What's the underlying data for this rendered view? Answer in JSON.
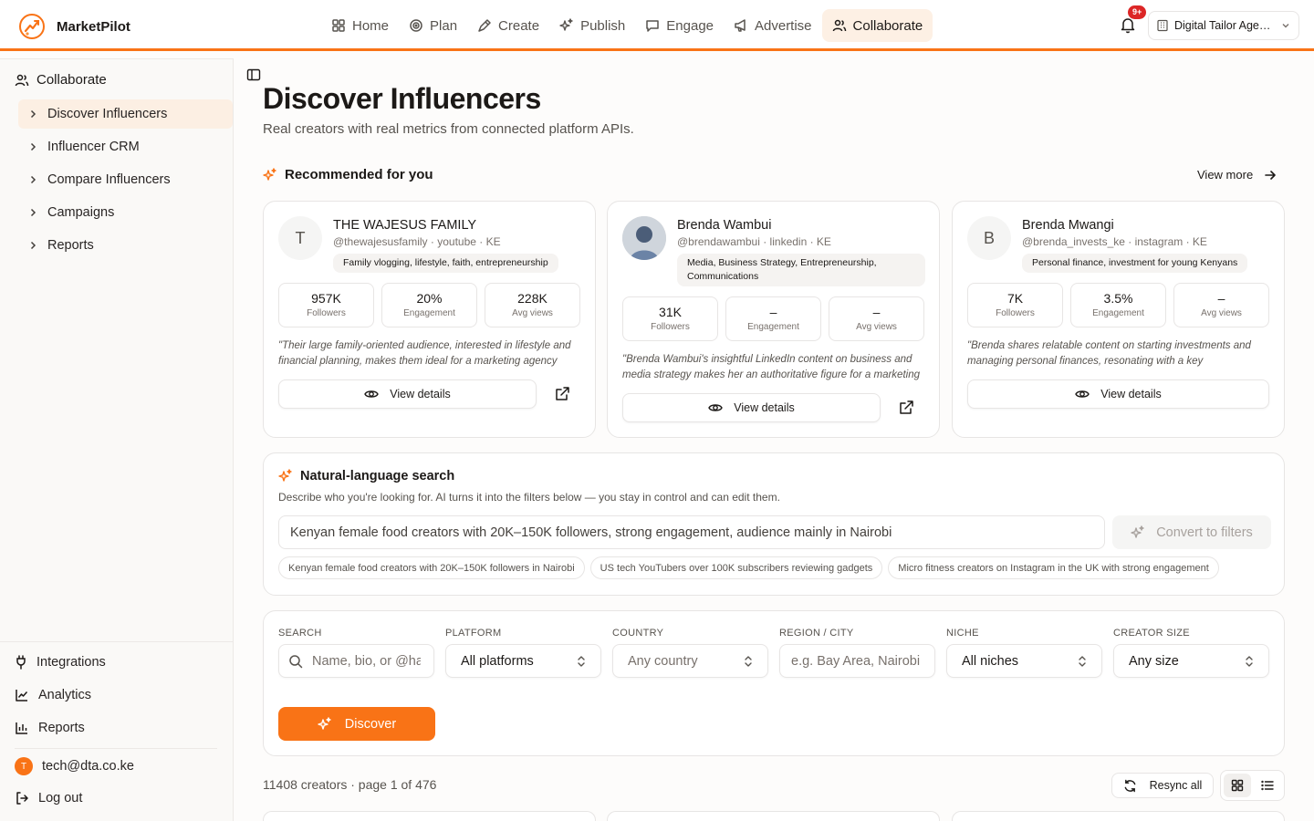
{
  "app": {
    "name": "MarketPilot"
  },
  "nav": {
    "items": [
      {
        "label": "Home",
        "icon": "grid-icon"
      },
      {
        "label": "Plan",
        "icon": "target-icon"
      },
      {
        "label": "Create",
        "icon": "pen-icon"
      },
      {
        "label": "Publish",
        "icon": "sparkles-icon"
      },
      {
        "label": "Engage",
        "icon": "message-icon"
      },
      {
        "label": "Advertise",
        "icon": "megaphone-icon"
      },
      {
        "label": "Collaborate",
        "icon": "users-icon",
        "active": true
      }
    ]
  },
  "notifications": {
    "badge": "9+"
  },
  "org": {
    "name": "Digital Tailor Agen..."
  },
  "sidebar": {
    "section": "Collaborate",
    "items": [
      {
        "label": "Discover Influencers",
        "active": true
      },
      {
        "label": "Influencer CRM"
      },
      {
        "label": "Compare Influencers"
      },
      {
        "label": "Campaigns"
      },
      {
        "label": "Reports"
      }
    ],
    "bottom": [
      {
        "label": "Integrations",
        "icon": "plug-icon"
      },
      {
        "label": "Analytics",
        "icon": "line-chart-icon"
      },
      {
        "label": "Reports",
        "icon": "bar-chart-icon"
      }
    ],
    "user": {
      "initial": "T",
      "email": "tech@dta.co.ke"
    },
    "logout": "Log out"
  },
  "page": {
    "title": "Discover Influencers",
    "subtitle": "Real creators with real metrics from connected platform APIs."
  },
  "recommended": {
    "title": "Recommended for you",
    "view_more": "View more",
    "cards": [
      {
        "initial": "T",
        "name": "THE WAJESUS FAMILY",
        "handle": "@thewajesusfamily · youtube · KE",
        "tag": "Family vlogging, lifestyle, faith, entrepreneurship",
        "stats": [
          {
            "value": "957K",
            "label": "Followers"
          },
          {
            "value": "20%",
            "label": "Engagement"
          },
          {
            "value": "228K",
            "label": "Avg views"
          }
        ],
        "quote": "\"Their large family-oriented audience, interested in lifestyle and financial planning, makes them ideal for a marketing agency targeting families.\"",
        "button": "View details"
      },
      {
        "initial": "",
        "name": "Brenda Wambui",
        "handle": "@brendawambui · linkedin · KE",
        "tag": "Media, Business Strategy, Entrepreneurship, Communications",
        "stats": [
          {
            "value": "31K",
            "label": "Followers"
          },
          {
            "value": "–",
            "label": "Engagement"
          },
          {
            "value": "–",
            "label": "Avg views"
          }
        ],
        "quote": "\"Brenda Wambui's insightful LinkedIn content on business and media strategy makes her an authoritative figure for a marketing agency.\"",
        "button": "View details"
      },
      {
        "initial": "B",
        "name": "Brenda Mwangi",
        "handle": "@brenda_invests_ke · instagram · KE",
        "tag": "Personal finance, investment for young Kenyans",
        "stats": [
          {
            "value": "7K",
            "label": "Followers"
          },
          {
            "value": "3.5%",
            "label": "Engagement"
          },
          {
            "value": "–",
            "label": "Avg views"
          }
        ],
        "quote": "\"Brenda shares relatable content on starting investments and managing personal finances, resonating with a key demographic.\"",
        "button": "View details"
      }
    ]
  },
  "nl_search": {
    "title": "Natural-language search",
    "description": "Describe who you're looking for. AI turns it into the filters below — you stay in control and can edit them.",
    "value": "Kenyan female food creators with 20K–150K followers, strong engagement, audience mainly in Nairobi",
    "convert_label": "Convert to filters",
    "examples": [
      "Kenyan female food creators with 20K–150K followers in Nairobi",
      "US tech YouTubers over 100K subscribers reviewing gadgets",
      "Micro fitness creators on Instagram in the UK with strong engagement"
    ]
  },
  "filters": {
    "search": {
      "label": "SEARCH",
      "placeholder": "Name, bio, or @handle"
    },
    "platform": {
      "label": "PLATFORM",
      "value": "All platforms"
    },
    "country": {
      "label": "COUNTRY",
      "value": "Any country"
    },
    "region": {
      "label": "REGION / CITY",
      "placeholder": "e.g. Bay Area, Nairobi"
    },
    "niche": {
      "label": "NICHE",
      "value": "All niches"
    },
    "size": {
      "label": "CREATOR SIZE",
      "value": "Any size"
    },
    "discover_label": "Discover"
  },
  "results": {
    "summary": "11408 creators · page 1 of 476",
    "resync_label": "Resync all",
    "view_mode": "grid"
  },
  "colors": {
    "accent": "#f97316",
    "active_bg": "#fdf0e4",
    "badge": "#dc2626"
  }
}
